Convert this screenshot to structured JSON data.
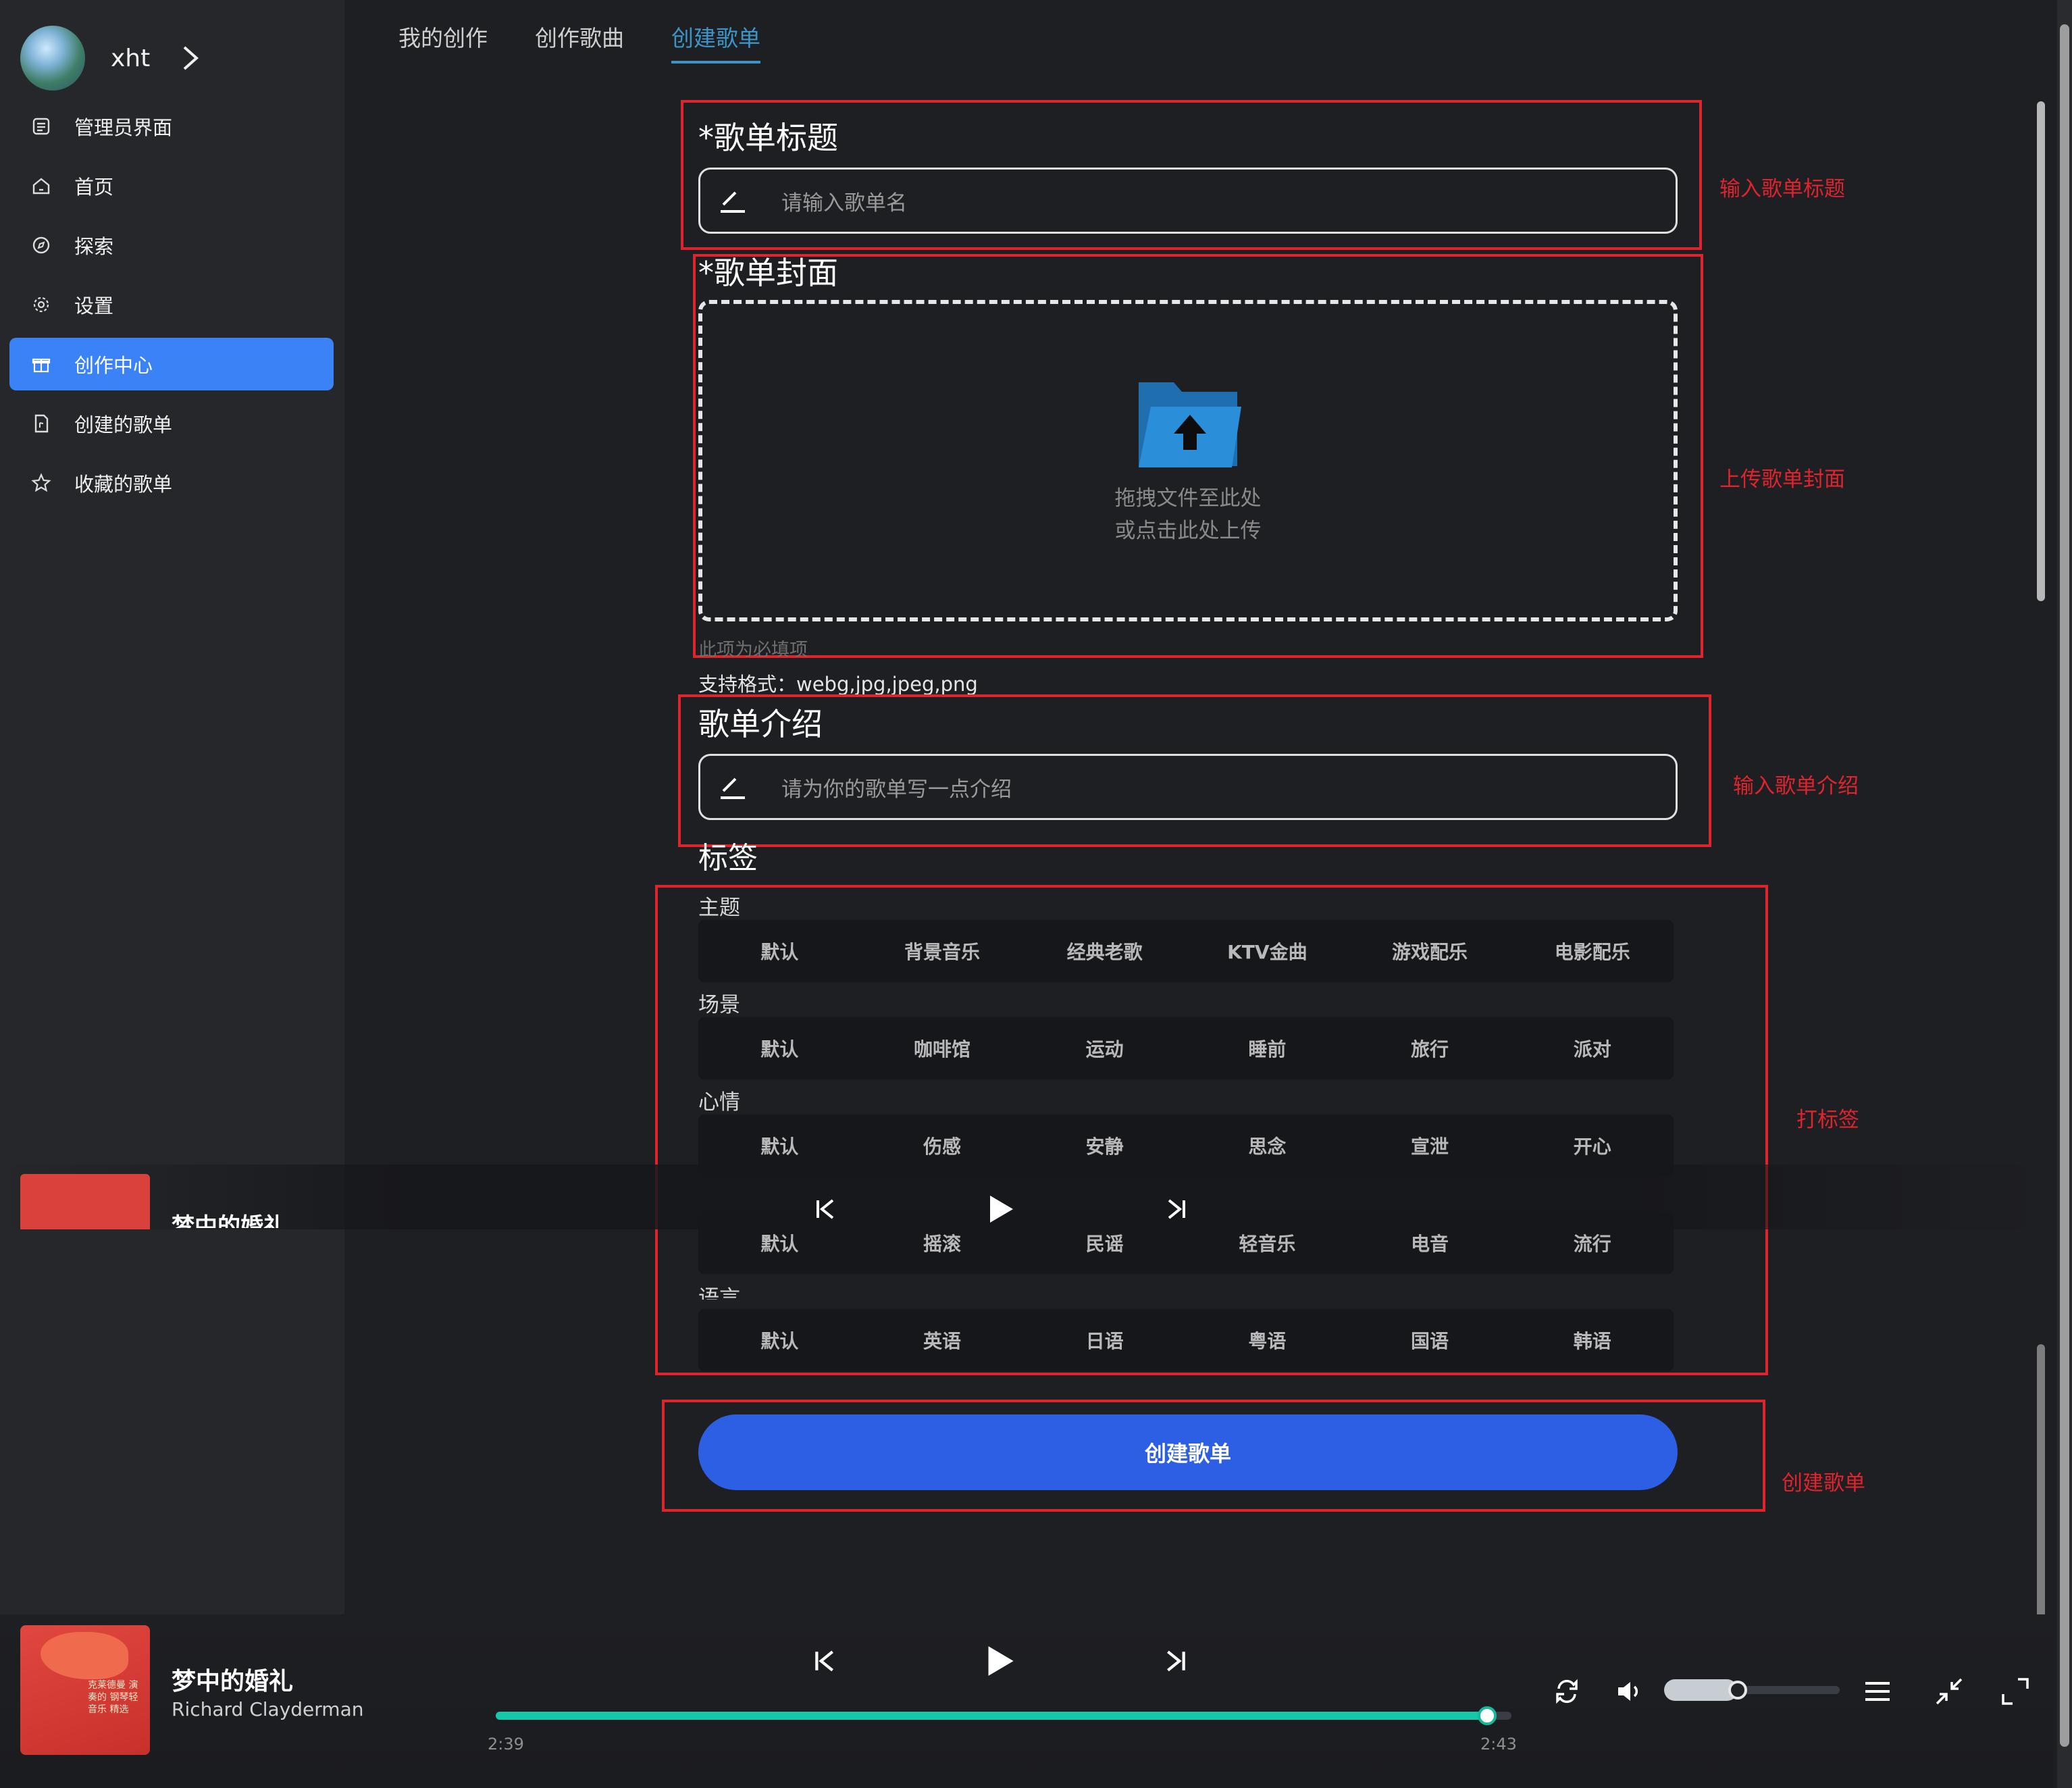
{
  "user": {
    "name": "xht"
  },
  "sidebar": {
    "items": [
      {
        "label": "管理员界面",
        "icon": "admin-icon"
      },
      {
        "label": "首页",
        "icon": "home-icon"
      },
      {
        "label": "探索",
        "icon": "compass-icon"
      },
      {
        "label": "设置",
        "icon": "gear-icon"
      },
      {
        "label": "创作中心",
        "icon": "gift-icon",
        "active": true
      },
      {
        "label": "创建的歌单",
        "icon": "document-icon"
      },
      {
        "label": "收藏的歌单",
        "icon": "star-icon"
      }
    ]
  },
  "tabs": [
    {
      "label": "我的创作"
    },
    {
      "label": "创作歌曲"
    },
    {
      "label": "创建歌单",
      "active": true
    }
  ],
  "form": {
    "title_label": "*歌单标题",
    "title_placeholder": "请输入歌单名",
    "cover_label": "*歌单封面",
    "upload_hint_1": "拖拽文件至此处",
    "upload_hint_2": "或点击此处上传",
    "required_note": "此项为必填项",
    "formats_note": "支持格式：webg,jpg,jpeg,png",
    "intro_label": "歌单介绍",
    "intro_placeholder": "请为你的歌单写一点介绍",
    "tags_label": "标签",
    "tag_groups": [
      {
        "name": "主题",
        "options": [
          "默认",
          "背景音乐",
          "经典老歌",
          "KTV金曲",
          "游戏配乐",
          "电影配乐"
        ]
      },
      {
        "name": "场景",
        "options": [
          "默认",
          "咖啡馆",
          "运动",
          "睡前",
          "旅行",
          "派对"
        ]
      },
      {
        "name": "心情",
        "options": [
          "默认",
          "伤感",
          "安静",
          "思念",
          "宣泄",
          "开心"
        ]
      },
      {
        "name": "",
        "options": [
          "默认",
          "摇滚",
          "民谣",
          "轻音乐",
          "电音",
          "流行"
        ]
      },
      {
        "name": "语言",
        "options": [
          "默认",
          "英语",
          "日语",
          "粤语",
          "国语",
          "韩语"
        ]
      }
    ],
    "create_button": "创建歌单"
  },
  "annotations": {
    "title": "输入歌单标题",
    "cover": "上传歌单封面",
    "intro": "输入歌单介绍",
    "tags": "打标签",
    "create": "创建歌单"
  },
  "player": {
    "song_title": "梦中的婚礼",
    "artist": "Richard Clayderman",
    "cover_caption": "克莱德曼 演奏的 钢琴轻音乐 精选",
    "current_time": "2:39",
    "total_time": "2:43",
    "progress": 0.976,
    "volume": 0.42
  },
  "colors": {
    "accent": "#3b82f6",
    "tab_active": "#3d95c7",
    "annotation_red": "#e0242e",
    "progress": "#16c7a9",
    "create_button": "#2c5fe3"
  }
}
